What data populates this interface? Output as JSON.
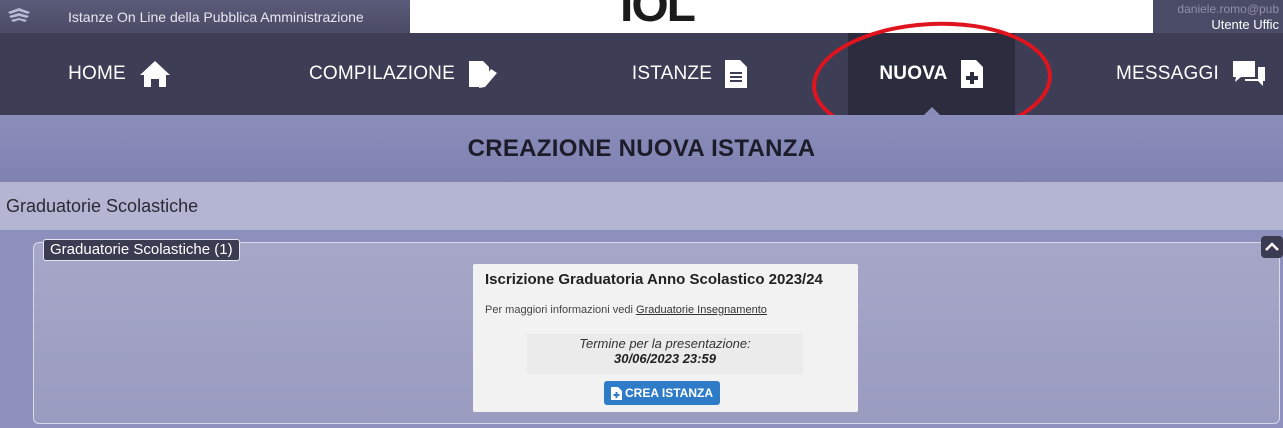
{
  "header": {
    "app_name": "Istanze On Line della Pubblica Amministrazione",
    "brand": "IOL",
    "user_email": "daniele.romo@pub",
    "user_role": "Utente Uffic"
  },
  "nav": {
    "items": [
      {
        "label": "HOME",
        "icon": "home-icon"
      },
      {
        "label": "COMPILAZIONE",
        "icon": "edit-document-icon"
      },
      {
        "label": "ISTANZE",
        "icon": "document-icon"
      },
      {
        "label": "NUOVA",
        "icon": "new-document-icon"
      },
      {
        "label": "MESSAGGI",
        "icon": "chat-icon"
      }
    ],
    "active": "NUOVA"
  },
  "page": {
    "title": "CREAZIONE NUOVA ISTANZA",
    "section": "Graduatorie Scolastiche"
  },
  "panel": {
    "legend": "Graduatorie Scolastiche (1)"
  },
  "card": {
    "title": "Iscrizione Graduatoria Anno Scolastico 2023/24",
    "info_prefix": "Per maggiori informazioni vedi",
    "info_link": "Graduatorie Insegnamento",
    "deadline_label": "Termine per la presentazione:",
    "deadline_value": "30/06/2023 23:59",
    "button_label": "CREA ISTANZA"
  },
  "colors": {
    "nav_bg": "#3d3d56",
    "nav_active_bg": "#2c2c3f",
    "title_band": "#8b8dbb",
    "button": "#2e7cc7",
    "annotation": "#e0141f"
  }
}
